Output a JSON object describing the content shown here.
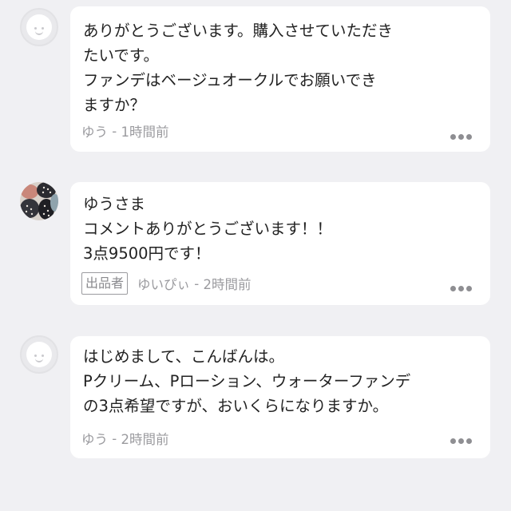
{
  "comments": [
    {
      "text": "ありがとうございます。購入させていただき\nたいです。\nファンデはベージュオークルでお願いでき\nますか？",
      "user": "ゆう",
      "separator": " - ",
      "time": "1時間前",
      "avatar": "default-avatar-icon"
    },
    {
      "text": "ゆうさま\nコメントありがとうございます！！\n3点9500円です！",
      "badge": "出品者",
      "user": "ゆいぴぃ",
      "separator": " - ",
      "time": "2時間前",
      "avatar": "seller-avatar-photo"
    },
    {
      "text": "はじめまして、こんばんは。\nPクリーム、Pローション、ウォーターファンデ\nの3点希望ですが、おいくらになりますか。",
      "user": "ゆう",
      "separator": " - ",
      "time": "2時間前",
      "avatar": "default-avatar-icon"
    }
  ],
  "colors": {
    "background": "#f0f0f3",
    "bubble": "#ffffff",
    "meta_text": "#9b9b9f",
    "body_text": "#222222"
  }
}
